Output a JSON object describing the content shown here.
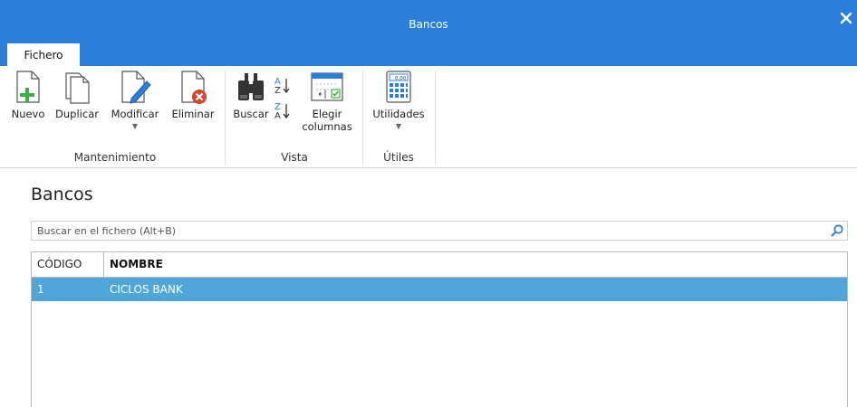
{
  "window": {
    "title": "Bancos"
  },
  "tabs": [
    {
      "label": "Fichero"
    }
  ],
  "ribbon": {
    "groups": [
      {
        "label": "Mantenimiento",
        "buttons": [
          {
            "label": "Nuevo",
            "icon": "new-document-icon"
          },
          {
            "label": "Duplicar",
            "icon": "duplicate-icon"
          },
          {
            "label": "Modificar",
            "icon": "edit-document-icon"
          },
          {
            "label": "Eliminar",
            "icon": "delete-document-icon"
          }
        ]
      },
      {
        "label": "Vista",
        "buttons": [
          {
            "label": "Buscar",
            "icon": "binoculars-icon"
          },
          {
            "label": "Elegir columnas",
            "line1": "Elegir",
            "line2": "columnas",
            "icon": "choose-columns-icon"
          }
        ]
      },
      {
        "label": "Útiles",
        "buttons": [
          {
            "label": "Utilidades",
            "icon": "calculator-icon"
          }
        ]
      }
    ]
  },
  "page": {
    "heading": "Bancos"
  },
  "search": {
    "placeholder": "Buscar en el fichero (Alt+B)"
  },
  "table": {
    "columns": [
      "CÓDIGO",
      "NOMBRE"
    ],
    "rows": [
      {
        "codigo": "1",
        "nombre": "CICLOS BANK",
        "selected": true
      }
    ]
  },
  "colors": {
    "accent": "#2b7fd9",
    "selection": "#4fa6d9",
    "add_green": "#3cb043",
    "delete_red": "#d9442b"
  }
}
